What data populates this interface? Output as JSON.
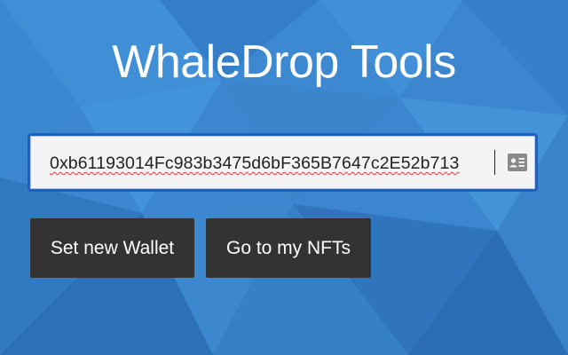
{
  "page": {
    "title": "WhaleDrop Tools"
  },
  "wallet_input": {
    "value": "0xb61193014Fc983b3475d6bF365B7647c2E52b713",
    "trailing_icon": "contact-card-icon"
  },
  "buttons": {
    "set_wallet_label": "Set new Wallet",
    "nfts_label": "Go to my NFTs"
  },
  "colors": {
    "background": "#3a86cf",
    "button": "#333333",
    "input_border": "#1f5fbf"
  }
}
